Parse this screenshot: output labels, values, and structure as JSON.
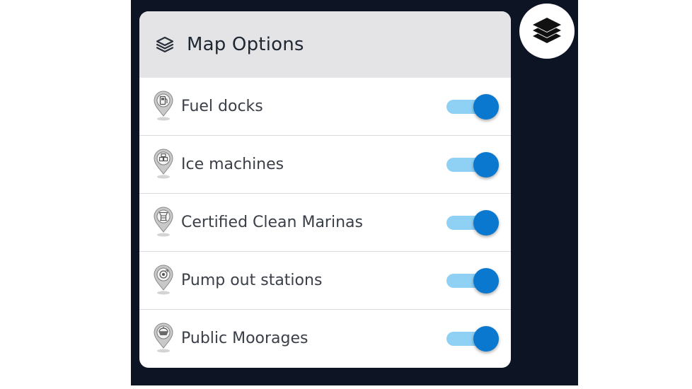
{
  "panel": {
    "title": "Map Options",
    "header_icon": "layers-outline-icon"
  },
  "layers_button": {
    "icon": "layers-icon"
  },
  "options": [
    {
      "label": "Fuel docks",
      "icon": "fuel-pump-pin-icon",
      "enabled": true
    },
    {
      "label": "Ice machines",
      "icon": "ice-machine-pin-icon",
      "enabled": true
    },
    {
      "label": "Certified Clean Marinas",
      "icon": "clean-marina-pin-icon",
      "enabled": true
    },
    {
      "label": "Pump out stations",
      "icon": "pump-out-pin-icon",
      "enabled": true
    },
    {
      "label": "Public Moorages",
      "icon": "mooring-buoy-pin-icon",
      "enabled": true
    }
  ],
  "colors": {
    "map_background": "#0d1525",
    "header_background": "#e4e4e6",
    "toggle_track_on": "#8fd0f5",
    "toggle_knob_on": "#0a78cf"
  }
}
